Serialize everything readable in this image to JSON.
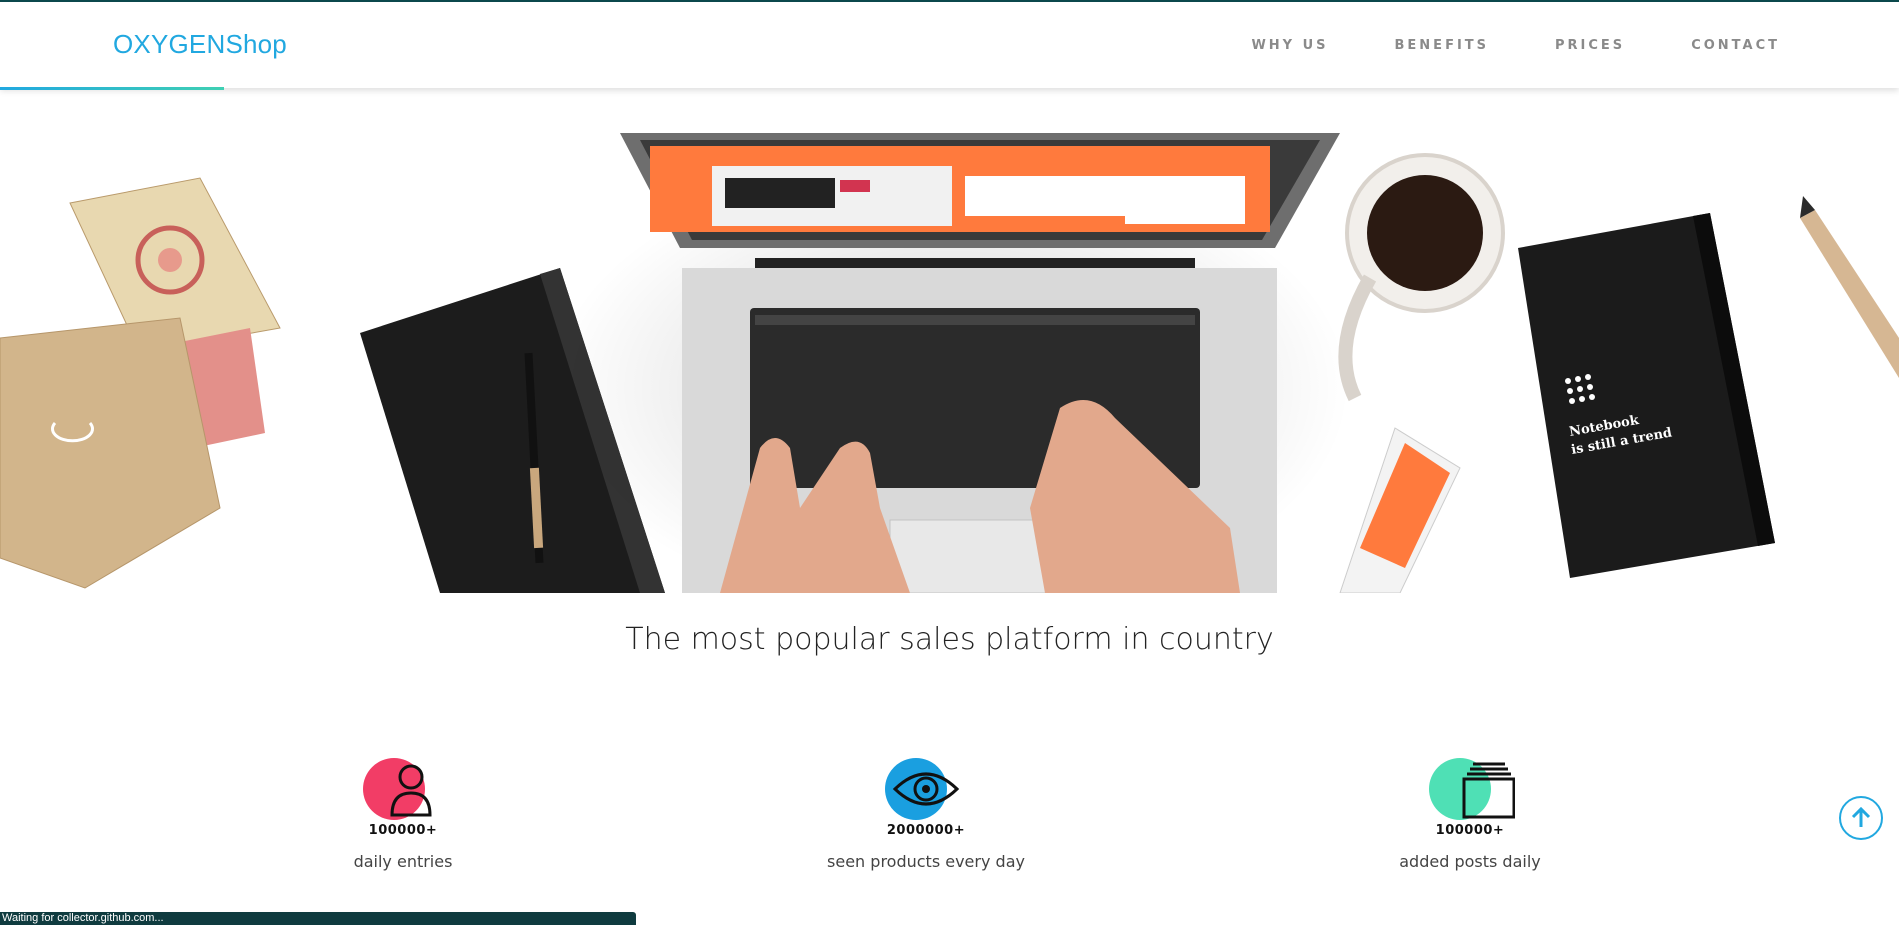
{
  "header": {
    "brand": "OXYGENShop",
    "nav": [
      "WHY US",
      "BENEFITS",
      "PRICES",
      "CONTACT"
    ]
  },
  "hero": {
    "notebook_text_line1": "Notebook",
    "notebook_text_line2": "is still a trend"
  },
  "tagline": "The most popular sales platform in country",
  "stats": [
    {
      "value": "100000+",
      "label": "daily entries",
      "icon": "user-icon",
      "color": "#f23d66"
    },
    {
      "value": "2000000+",
      "label": "seen products every day",
      "icon": "eye-icon",
      "color": "#1a9fe0"
    },
    {
      "value": "100000+",
      "label": "added posts daily",
      "icon": "posts-icon",
      "color": "#4fe0b5"
    }
  ],
  "scroll_top": {
    "icon": "arrow-up-icon"
  },
  "status_bar": "Waiting for collector.github.com..."
}
